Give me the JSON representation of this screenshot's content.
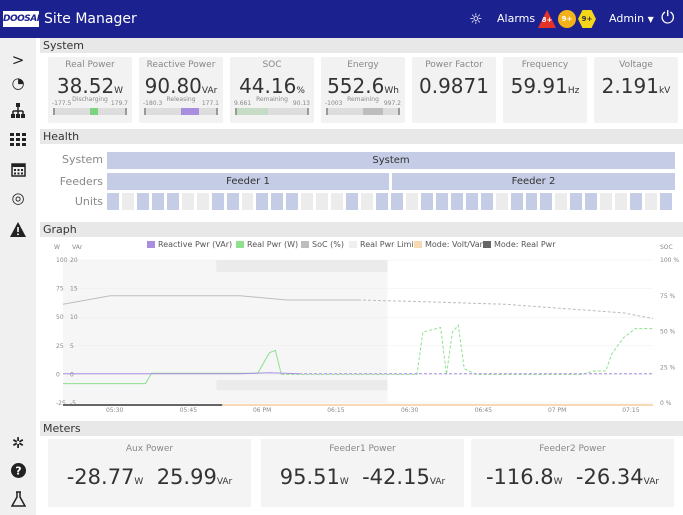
{
  "header": {
    "logo": "DOOSAN",
    "title": "Site Manager",
    "alarms_label": "Alarms",
    "alarm_badges": [
      {
        "type": "critical",
        "text": "8+",
        "color": "#e63128"
      },
      {
        "type": "major",
        "text": "9+",
        "color": "#f3b21a"
      },
      {
        "type": "minor",
        "text": "9+",
        "color": "#f3d51a"
      }
    ],
    "user_label": "Admin",
    "icons": [
      "sun-icon",
      "chevron-down-icon",
      "power-icon"
    ]
  },
  "sidebar": {
    "top_items": [
      {
        "name": "expand-icon",
        "glyph": ">"
      },
      {
        "name": "dashboard-icon",
        "glyph": "◔"
      },
      {
        "name": "sitemap-icon",
        "glyph": "⊥"
      },
      {
        "name": "grid-icon",
        "glyph": "▦"
      },
      {
        "name": "calendar-icon",
        "glyph": "▤"
      },
      {
        "name": "target-icon",
        "glyph": "◎"
      },
      {
        "name": "warning-icon",
        "glyph": "▲"
      }
    ],
    "bottom_items": [
      {
        "name": "settings-icon",
        "glyph": "✲"
      },
      {
        "name": "help-icon",
        "glyph": "?"
      },
      {
        "name": "lab-icon",
        "glyph": "⚗"
      }
    ]
  },
  "system": {
    "title": "System",
    "cards": [
      {
        "title": "Real Power",
        "value": "38.52",
        "unit": "W",
        "min": "-177.5",
        "max": "179.7",
        "mode": "Discharging",
        "fill_from": 0.5,
        "fill_to": 0.61,
        "fill_color": "#7ed37e"
      },
      {
        "title": "Reactive Power",
        "value": "90.80",
        "unit": "VAr",
        "min": "-180.3",
        "max": "177.1",
        "mode": "Releasing",
        "fill_from": 0.5,
        "fill_to": 0.75,
        "fill_color": "#a98ee0"
      },
      {
        "title": "SOC",
        "value": "44.16",
        "unit": "%",
        "min": "9.661",
        "max": "90.13",
        "mode": "Remaining",
        "fill_from": 0.0,
        "fill_to": 0.44,
        "fill_color": "#c6dcc6"
      },
      {
        "title": "Energy",
        "value": "552.6",
        "unit": "Wh",
        "min": "-1003",
        "max": "997.2",
        "mode": "Remaining",
        "fill_from": 0.5,
        "fill_to": 0.78,
        "fill_color": "#bdbdbd"
      },
      {
        "title": "Power Factor",
        "value": "0.9871",
        "unit": ""
      },
      {
        "title": "Frequency",
        "value": "59.91",
        "unit": "Hz"
      },
      {
        "title": "Voltage",
        "value": "2.191",
        "unit": "kV"
      }
    ]
  },
  "health": {
    "title": "Health",
    "row_labels": [
      "System",
      "Feeders",
      "Units"
    ],
    "system_label": "System",
    "feeders": [
      "Feeder 1",
      "Feeder 2"
    ],
    "units": [
      1,
      0,
      1,
      1,
      1,
      0,
      0,
      1,
      1,
      0,
      1,
      1,
      1,
      0,
      0,
      0,
      1,
      0,
      1,
      1,
      0,
      1,
      1,
      1,
      1,
      1,
      0,
      1,
      1,
      1,
      0,
      1,
      1,
      0,
      0,
      1,
      0,
      1
    ],
    "colors": {
      "ok": "#c4cce6",
      "idle": "#ececec"
    }
  },
  "graph": {
    "title": "Graph",
    "left_axis_labels": [
      "W",
      "VAr"
    ],
    "right_axis_label": "SOC",
    "legend": [
      {
        "label": "Reactive Pwr (VAr)",
        "color": "#a98ee0"
      },
      {
        "label": "Real Pwr (W)",
        "color": "#8fe08f"
      },
      {
        "label": "SoC (%)",
        "color": "#bdbdbd"
      },
      {
        "label": "Real Pwr Limits",
        "color": "#efefef"
      },
      {
        "label": "Mode: Volt/Var",
        "color": "#f7d9b2"
      },
      {
        "label": "Mode: Real Pwr",
        "color": "#666666"
      }
    ]
  },
  "chart_data": {
    "type": "line",
    "x": [
      "05:30",
      "05:45",
      "06 PM",
      "06:15",
      "06:30",
      "06:45",
      "07 PM",
      "07:15"
    ],
    "y_w_ticks": [
      "100",
      "75",
      "50",
      "25",
      "0",
      "-25"
    ],
    "y_var_ticks": [
      "20",
      "15",
      "10",
      "5",
      "0",
      "-5"
    ],
    "y_soc_ticks": [
      "100 %",
      "75 %",
      "50 %",
      "25 %",
      "0 %"
    ],
    "ylim_w": [
      -25,
      100
    ],
    "ylim_soc": [
      0,
      100
    ],
    "series": [
      {
        "name": "SoC (%)",
        "color": "#bdbdbd",
        "points": [
          [
            0,
            69
          ],
          [
            0.08,
            75
          ],
          [
            0.3,
            75
          ],
          [
            0.38,
            72
          ],
          [
            0.5,
            72
          ],
          [
            0.6,
            71
          ],
          [
            0.75,
            69
          ],
          [
            0.95,
            63
          ],
          [
            1.0,
            59
          ]
        ]
      },
      {
        "name": "Real Pwr (W)",
        "color": "#8fe08f",
        "points": [
          [
            0,
            -8
          ],
          [
            0.14,
            -8
          ],
          [
            0.15,
            1
          ],
          [
            0.33,
            1
          ],
          [
            0.35,
            19
          ],
          [
            0.36,
            21
          ],
          [
            0.37,
            0
          ],
          [
            0.6,
            0
          ],
          [
            0.61,
            37
          ],
          [
            0.64,
            41
          ],
          [
            0.65,
            0
          ],
          [
            0.66,
            37
          ],
          [
            0.67,
            43
          ],
          [
            0.68,
            5
          ],
          [
            0.7,
            0
          ],
          [
            0.88,
            0
          ],
          [
            0.9,
            3
          ],
          [
            0.92,
            3
          ],
          [
            0.93,
            18
          ],
          [
            0.95,
            32
          ],
          [
            0.97,
            40
          ],
          [
            1.0,
            40
          ]
        ]
      },
      {
        "name": "Reactive Pwr (VAr)",
        "color": "#a98ee0",
        "points": [
          [
            0,
            0.5
          ],
          [
            0.3,
            0.5
          ],
          [
            0.35,
            1.5
          ],
          [
            0.4,
            0.5
          ],
          [
            1.0,
            0.5
          ]
        ]
      }
    ]
  },
  "meters": {
    "title": "Meters",
    "cards": [
      {
        "title": "Aux Power",
        "w": "-28.77",
        "w_unit": "W",
        "var": "25.99",
        "var_unit": "VAr"
      },
      {
        "title": "Feeder1 Power",
        "w": "95.51",
        "w_unit": "W",
        "var": "-42.15",
        "var_unit": "VAr"
      },
      {
        "title": "Feeder2 Power",
        "w": "-116.8",
        "w_unit": "W",
        "var": "-26.34",
        "var_unit": "VAr"
      }
    ]
  }
}
